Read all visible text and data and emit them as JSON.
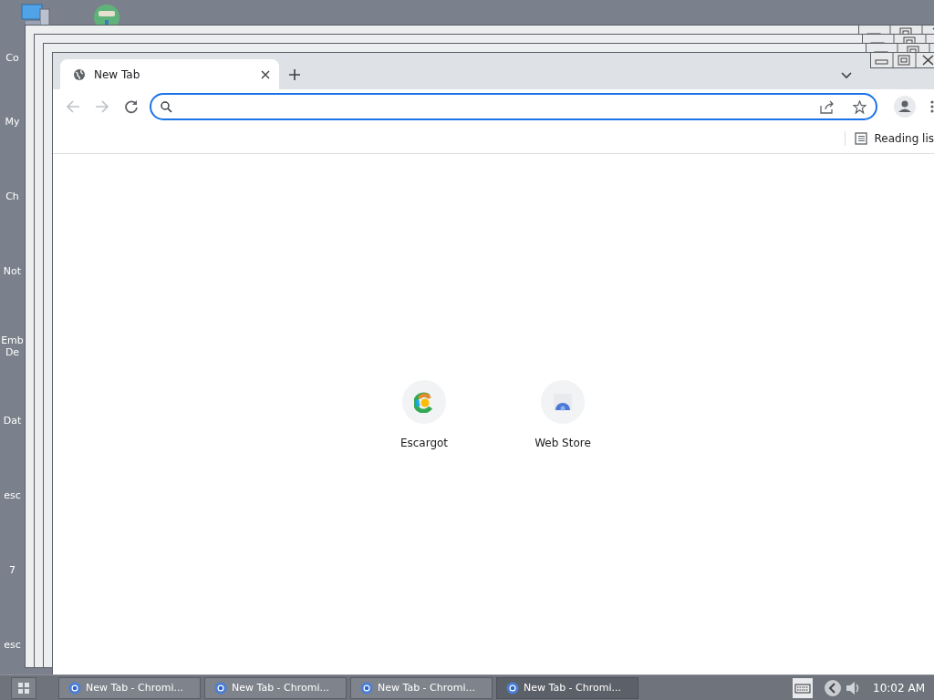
{
  "desktop_icons": [
    {
      "label": "Co"
    },
    {
      "label": "My"
    },
    {
      "label": "Ch"
    },
    {
      "label": "Not"
    },
    {
      "label": "Emb De"
    },
    {
      "label": "Dat"
    },
    {
      "label": "esc"
    },
    {
      "label": "7"
    },
    {
      "label": "esc"
    }
  ],
  "browser": {
    "tabs": [
      {
        "title": "New Tab",
        "selected": true
      }
    ],
    "omnibox": {
      "focused": true
    },
    "bookmarks_bar": {
      "reading_list": "Reading lis"
    },
    "shortcuts": [
      {
        "label": "Escargot",
        "kind": "escargot"
      },
      {
        "label": "Web Store",
        "kind": "webstore"
      }
    ]
  },
  "taskbar": {
    "items": [
      {
        "label": "New Tab - Chromi...",
        "selected": false
      },
      {
        "label": "New Tab - Chromi...",
        "selected": false
      },
      {
        "label": "New Tab - Chromi...",
        "selected": false
      },
      {
        "label": "New Tab - Chromi...",
        "selected": true
      }
    ],
    "clock": "10:02 AM"
  }
}
